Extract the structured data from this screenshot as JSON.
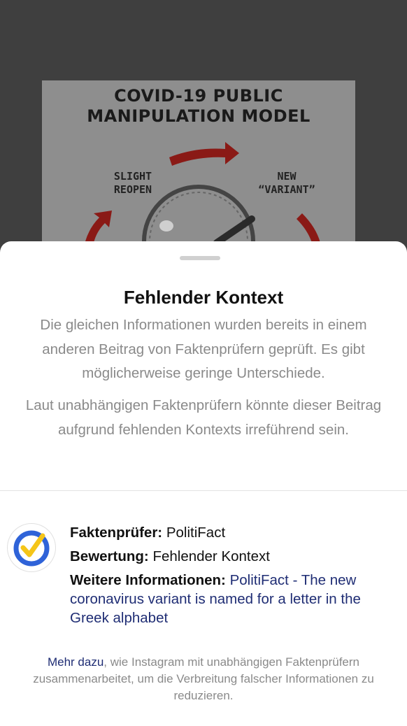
{
  "post": {
    "title_line1": "COVID-19 PUBLIC",
    "title_line2": "MANIPULATION MODEL",
    "label_reopen_1": "SLIGHT",
    "label_reopen_2": "REOPEN",
    "label_variant_1": "NEW",
    "label_variant_2": "“VARIANT”"
  },
  "sheet": {
    "title": "Fehlender Kontext",
    "para1": "Die gleichen Informationen wurden bereits in einem anderen Beitrag von Faktenprüfern geprüft. Es gibt möglicherweise geringe Unterschiede.",
    "para2": "Laut unabhängigen Faktenprüfern könnte dieser Beitrag aufgrund fehlenden Kontexts irreführend sein."
  },
  "factcheck": {
    "checker_label": "Faktenprüfer:",
    "checker_value": "PolitiFact",
    "rating_label": "Bewertung:",
    "rating_value": "Fehlender Kontext",
    "more_label": "Weitere Informationen:",
    "more_link": "PolitiFact - The new coronavirus variant is named for a letter in the Greek alphabet"
  },
  "footer": {
    "link": "Mehr dazu",
    "text": ", wie Instagram mit unabhängigen Faktenprüfern zusammenarbeitet, um die Verbreitung falscher Informationen zu reduzieren."
  },
  "colors": {
    "backdrop": "#3f3f3f",
    "link": "#1f2d74",
    "badge_blue": "#2f63d8",
    "badge_yellow": "#f5c518"
  }
}
